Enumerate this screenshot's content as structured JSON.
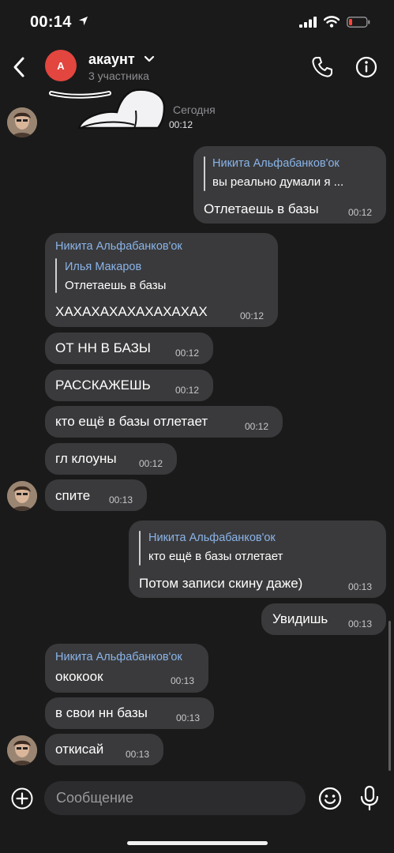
{
  "status": {
    "time": "00:14"
  },
  "header": {
    "avatar_letter": "A",
    "title": "акаунт",
    "subtitle": "3 участника"
  },
  "date_divider": "Сегодня",
  "sticker_time": "00:12",
  "messages": [
    {
      "name": "Никита Альфабанков'ок",
      "quote": "вы реально думали я ...",
      "text": "Отлетаешь в базы",
      "time": "00:12"
    },
    {
      "name": "Никита Альфабанков'ок",
      "quote_name": "Илья Макаров",
      "quote": "Отлетаешь в базы",
      "text": "ХАХАХАХАХАХАХАХАХ",
      "time": "00:12"
    },
    {
      "text": "ОТ НН В БАЗЫ",
      "time": "00:12"
    },
    {
      "text": "РАССКАЖЕШЬ",
      "time": "00:12"
    },
    {
      "text": "кто ещё в базы отлетает",
      "time": "00:12"
    },
    {
      "text": "гл клоуны",
      "time": "00:12"
    },
    {
      "text": "спите",
      "time": "00:13"
    },
    {
      "name": "Никита Альфабанков'ок",
      "quote": "кто ещё в базы отлетает",
      "text": "Потом записи скину даже)",
      "time": "00:13"
    },
    {
      "text": "Увидишь",
      "time": "00:13"
    },
    {
      "name": "Никита Альфабанков'ок",
      "text": "ококоок",
      "time": "00:13"
    },
    {
      "text": "в свои нн базы",
      "time": "00:13"
    },
    {
      "text": "откисай",
      "time": "00:13"
    }
  ],
  "composer": {
    "placeholder": "Сообщение"
  },
  "colors": {
    "background": "#1a1a1a",
    "bubble": "#3a3a3c",
    "name": "#8ab4e8",
    "avatar": "#e2463f"
  },
  "icons": [
    "back-icon",
    "chevron-down-icon",
    "phone-icon",
    "info-icon",
    "plus-icon",
    "emoji-icon",
    "microphone-icon",
    "signal-icon",
    "wifi-icon",
    "battery-icon",
    "location-arrow-icon"
  ]
}
